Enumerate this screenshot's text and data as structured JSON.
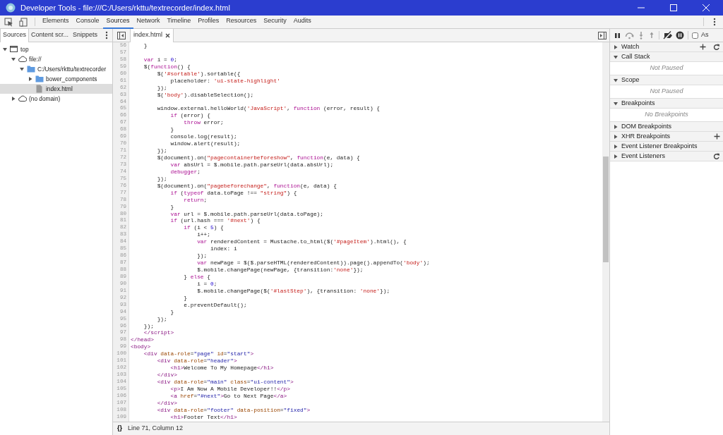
{
  "window": {
    "title": "Developer Tools - file:///C:/Users/rkttu/textrecorder/index.html"
  },
  "main_tabs": [
    {
      "label": "Elements",
      "selected": false
    },
    {
      "label": "Console",
      "selected": false
    },
    {
      "label": "Sources",
      "selected": true
    },
    {
      "label": "Network",
      "selected": false
    },
    {
      "label": "Timeline",
      "selected": false
    },
    {
      "label": "Profiles",
      "selected": false
    },
    {
      "label": "Resources",
      "selected": false
    },
    {
      "label": "Security",
      "selected": false
    },
    {
      "label": "Audits",
      "selected": false
    }
  ],
  "navigator": {
    "tabs": [
      {
        "label": "Sources",
        "selected": true
      },
      {
        "label": "Content scr...",
        "selected": false
      },
      {
        "label": "Snippets",
        "selected": false
      }
    ],
    "tree": [
      {
        "label": "top",
        "kind": "frame",
        "expanded": true,
        "selected": false,
        "children": [
          {
            "label": "file://",
            "kind": "cloud",
            "expanded": true,
            "selected": false,
            "children": [
              {
                "label": "C:/Users/rkttu/textrecorder",
                "kind": "folder",
                "expanded": true,
                "selected": false,
                "children": [
                  {
                    "label": "bower_components",
                    "kind": "folder",
                    "expanded": false,
                    "selected": false
                  },
                  {
                    "label": "index.html",
                    "kind": "file",
                    "selected": true
                  }
                ]
              }
            ]
          },
          {
            "label": "(no domain)",
            "kind": "cloud",
            "expanded": false,
            "selected": false
          }
        ]
      }
    ]
  },
  "editor": {
    "tabs": [
      {
        "label": "index.html",
        "selected": true,
        "closable": true
      }
    ],
    "lines": [
      {
        "number": "56",
        "tokens": [
          {
            "text": "    }"
          }
        ]
      },
      {
        "number": "57"
      },
      {
        "number": "58",
        "tokens": [
          {
            "text": "    var",
            "kind": "keyword"
          },
          {
            "text": " i = "
          },
          {
            "text": "0",
            "kind": "number"
          },
          {
            "text": ";"
          }
        ]
      },
      {
        "number": "59",
        "tokens": [
          {
            "text": "    $("
          },
          {
            "text": "function",
            "kind": "keyword"
          },
          {
            "text": "() {"
          }
        ]
      },
      {
        "number": "60",
        "tokens": [
          {
            "text": "        $("
          },
          {
            "text": "'#sortable'",
            "kind": "string"
          },
          {
            "text": ").sortable({"
          }
        ]
      },
      {
        "number": "61",
        "tokens": [
          {
            "text": "            placeholder: "
          },
          {
            "text": "'ui-state-highlight'",
            "kind": "string"
          }
        ]
      },
      {
        "number": "62",
        "tokens": [
          {
            "text": "        });"
          }
        ]
      },
      {
        "number": "63",
        "tokens": [
          {
            "text": "        $("
          },
          {
            "text": "'body'",
            "kind": "string"
          },
          {
            "text": ").disableSelection();"
          }
        ]
      },
      {
        "number": "64"
      },
      {
        "number": "65",
        "tokens": [
          {
            "text": "        window.external.helloWorld("
          },
          {
            "text": "'JavaScript'",
            "kind": "string"
          },
          {
            "text": ", "
          },
          {
            "text": "function",
            "kind": "keyword"
          },
          {
            "text": " (error, result) {"
          }
        ]
      },
      {
        "number": "66",
        "tokens": [
          {
            "text": "            if",
            "kind": "keyword"
          },
          {
            "text": " (error) {"
          }
        ]
      },
      {
        "number": "67",
        "tokens": [
          {
            "text": "                throw",
            "kind": "keyword"
          },
          {
            "text": " error;"
          }
        ]
      },
      {
        "number": "68",
        "tokens": [
          {
            "text": "            }"
          }
        ]
      },
      {
        "number": "69",
        "tokens": [
          {
            "text": "            console.log(result);"
          }
        ]
      },
      {
        "number": "70",
        "tokens": [
          {
            "text": "            window.alert(result);"
          }
        ]
      },
      {
        "number": "71",
        "tokens": [
          {
            "text": "        });"
          }
        ]
      },
      {
        "number": "72",
        "tokens": [
          {
            "text": "        $(document).on("
          },
          {
            "text": "\"pagecontainerbeforeshow\"",
            "kind": "string"
          },
          {
            "text": ", "
          },
          {
            "text": "function",
            "kind": "keyword"
          },
          {
            "text": "(e, data) {"
          }
        ]
      },
      {
        "number": "73",
        "tokens": [
          {
            "text": "            var",
            "kind": "keyword"
          },
          {
            "text": " absUrl = $.mobile.path.parseUrl(data.absUrl);"
          }
        ]
      },
      {
        "number": "74",
        "tokens": [
          {
            "text": "            debugger",
            "kind": "keyword"
          },
          {
            "text": ";"
          }
        ]
      },
      {
        "number": "75",
        "tokens": [
          {
            "text": "        });"
          }
        ]
      },
      {
        "number": "76",
        "tokens": [
          {
            "text": "        $(document).on("
          },
          {
            "text": "\"pagebeforechange\"",
            "kind": "string"
          },
          {
            "text": ", "
          },
          {
            "text": "function",
            "kind": "keyword"
          },
          {
            "text": "(e, data) {"
          }
        ]
      },
      {
        "number": "77",
        "tokens": [
          {
            "text": "            if",
            "kind": "keyword"
          },
          {
            "text": " ("
          },
          {
            "text": "typeof",
            "kind": "keyword"
          },
          {
            "text": " data.toPage !== "
          },
          {
            "text": "\"string\"",
            "kind": "string"
          },
          {
            "text": ") {"
          }
        ]
      },
      {
        "number": "78",
        "tokens": [
          {
            "text": "                return",
            "kind": "keyword"
          },
          {
            "text": ";"
          }
        ]
      },
      {
        "number": "79",
        "tokens": [
          {
            "text": "            }"
          }
        ]
      },
      {
        "number": "80",
        "tokens": [
          {
            "text": "            var",
            "kind": "keyword"
          },
          {
            "text": " url = $.mobile.path.parseUrl(data.toPage);"
          }
        ]
      },
      {
        "number": "81",
        "tokens": [
          {
            "text": "            if",
            "kind": "keyword"
          },
          {
            "text": " (url.hash === "
          },
          {
            "text": "'#next'",
            "kind": "string"
          },
          {
            "text": ") {"
          }
        ]
      },
      {
        "number": "82",
        "tokens": [
          {
            "text": "                if",
            "kind": "keyword"
          },
          {
            "text": " (i < "
          },
          {
            "text": "5",
            "kind": "number"
          },
          {
            "text": ") {"
          }
        ]
      },
      {
        "number": "83",
        "tokens": [
          {
            "text": "                    i++;"
          }
        ]
      },
      {
        "number": "84",
        "tokens": [
          {
            "text": "                    var",
            "kind": "keyword"
          },
          {
            "text": " renderedContent = Mustache.to_html($("
          },
          {
            "text": "'#pageItem'",
            "kind": "string"
          },
          {
            "text": ").html(), {"
          }
        ]
      },
      {
        "number": "85",
        "tokens": [
          {
            "text": "                        index: i"
          }
        ]
      },
      {
        "number": "86",
        "tokens": [
          {
            "text": "                    });"
          }
        ]
      },
      {
        "number": "87",
        "tokens": [
          {
            "text": "                    var",
            "kind": "keyword"
          },
          {
            "text": " newPage = $($.parseHTML(renderedContent)).page().appendTo("
          },
          {
            "text": "'body'",
            "kind": "string"
          },
          {
            "text": ");"
          }
        ]
      },
      {
        "number": "88",
        "tokens": [
          {
            "text": "                    $.mobile.changePage(newPage, {transition:"
          },
          {
            "text": "'none'",
            "kind": "string"
          },
          {
            "text": "});"
          }
        ]
      },
      {
        "number": "89",
        "tokens": [
          {
            "text": "                } "
          },
          {
            "text": "else",
            "kind": "keyword"
          },
          {
            "text": " {"
          }
        ]
      },
      {
        "number": "90",
        "tokens": [
          {
            "text": "                    i = "
          },
          {
            "text": "0",
            "kind": "number"
          },
          {
            "text": ";"
          }
        ]
      },
      {
        "number": "91",
        "tokens": [
          {
            "text": "                    $.mobile.changePage($("
          },
          {
            "text": "'#lastStep'",
            "kind": "string"
          },
          {
            "text": "), {transition: "
          },
          {
            "text": "'none'",
            "kind": "string"
          },
          {
            "text": "});"
          }
        ]
      },
      {
        "number": "92",
        "tokens": [
          {
            "text": "                }"
          }
        ]
      },
      {
        "number": "93",
        "tokens": [
          {
            "text": "                e.preventDefault();"
          }
        ]
      },
      {
        "number": "94",
        "tokens": [
          {
            "text": "            }"
          }
        ]
      },
      {
        "number": "95",
        "tokens": [
          {
            "text": "        });"
          }
        ]
      },
      {
        "number": "96",
        "tokens": [
          {
            "text": "    });"
          }
        ]
      },
      {
        "number": "97",
        "tokens": [
          {
            "text": "    </script>",
            "kind": "tag"
          }
        ]
      },
      {
        "number": "98",
        "tokens": [
          {
            "text": "</head>",
            "kind": "tag"
          }
        ]
      },
      {
        "number": "99",
        "tokens": [
          {
            "text": "<body>",
            "kind": "tag"
          }
        ]
      },
      {
        "number": "100",
        "tokens": [
          {
            "text": "    <div",
            "kind": "tag"
          },
          {
            "text": " data-role",
            "kind": "attribute"
          },
          {
            "text": "="
          },
          {
            "text": "\"page\"",
            "kind": "value"
          },
          {
            "text": " id",
            "kind": "attribute"
          },
          {
            "text": "="
          },
          {
            "text": "\"start\"",
            "kind": "value"
          },
          {
            "text": ">",
            "kind": "tag"
          }
        ]
      },
      {
        "number": "101",
        "tokens": [
          {
            "text": "        <div",
            "kind": "tag"
          },
          {
            "text": " data-role",
            "kind": "attribute"
          },
          {
            "text": "="
          },
          {
            "text": "\"header\"",
            "kind": "value"
          },
          {
            "text": ">",
            "kind": "tag"
          }
        ]
      },
      {
        "number": "102",
        "tokens": [
          {
            "text": "            <h1>",
            "kind": "tag"
          },
          {
            "text": "Welcome To My Homepage"
          },
          {
            "text": "</h1>",
            "kind": "tag"
          }
        ]
      },
      {
        "number": "103",
        "tokens": [
          {
            "text": "        </div>",
            "kind": "tag"
          }
        ]
      },
      {
        "number": "104",
        "tokens": [
          {
            "text": "        <div",
            "kind": "tag"
          },
          {
            "text": " data-role",
            "kind": "attribute"
          },
          {
            "text": "="
          },
          {
            "text": "\"main\"",
            "kind": "value"
          },
          {
            "text": " class",
            "kind": "attribute"
          },
          {
            "text": "="
          },
          {
            "text": "\"ui-content\"",
            "kind": "value"
          },
          {
            "text": ">",
            "kind": "tag"
          }
        ]
      },
      {
        "number": "105",
        "tokens": [
          {
            "text": "            <p>",
            "kind": "tag"
          },
          {
            "text": "I Am Now A Mobile Developer!!"
          },
          {
            "text": "</p>",
            "kind": "tag"
          }
        ]
      },
      {
        "number": "106",
        "tokens": [
          {
            "text": "            <a",
            "kind": "tag"
          },
          {
            "text": " href",
            "kind": "attribute"
          },
          {
            "text": "="
          },
          {
            "text": "\"#next\"",
            "kind": "value"
          },
          {
            "text": ">",
            "kind": "tag"
          },
          {
            "text": "Go to Next Page"
          },
          {
            "text": "</a>",
            "kind": "tag"
          }
        ]
      },
      {
        "number": "107",
        "tokens": [
          {
            "text": "        </div>",
            "kind": "tag"
          }
        ]
      },
      {
        "number": "108",
        "tokens": [
          {
            "text": "        <div",
            "kind": "tag"
          },
          {
            "text": " data-role",
            "kind": "attribute"
          },
          {
            "text": "="
          },
          {
            "text": "\"footer\"",
            "kind": "value"
          },
          {
            "text": " data-position",
            "kind": "attribute"
          },
          {
            "text": "="
          },
          {
            "text": "\"fixed\"",
            "kind": "value"
          },
          {
            "text": ">",
            "kind": "tag"
          }
        ]
      },
      {
        "number": "109",
        "tokens": [
          {
            "text": "            <h1>",
            "kind": "tag"
          },
          {
            "text": "Footer Text"
          },
          {
            "text": "</h1>",
            "kind": "tag"
          }
        ]
      }
    ],
    "status_bar": {
      "format_button": "{}",
      "position": "Line 71, Column 12"
    }
  },
  "debugger": {
    "async_checkbox": {
      "label": "As",
      "checked": false
    },
    "sections": [
      {
        "title": "Watch",
        "expanded": false,
        "add_button": true,
        "refresh_button": true
      },
      {
        "title": "Call Stack",
        "expanded": true,
        "message": "Not Paused"
      },
      {
        "title": "Scope",
        "expanded": true,
        "message": "Not Paused"
      },
      {
        "title": "Breakpoints",
        "expanded": true,
        "message": "No Breakpoints"
      },
      {
        "title": "DOM Breakpoints",
        "expanded": false
      },
      {
        "title": "XHR Breakpoints",
        "expanded": false,
        "add_button": true
      },
      {
        "title": "Event Listener Breakpoints",
        "expanded": false
      },
      {
        "title": "Event Listeners",
        "expanded": false,
        "refresh_button": true
      }
    ]
  }
}
